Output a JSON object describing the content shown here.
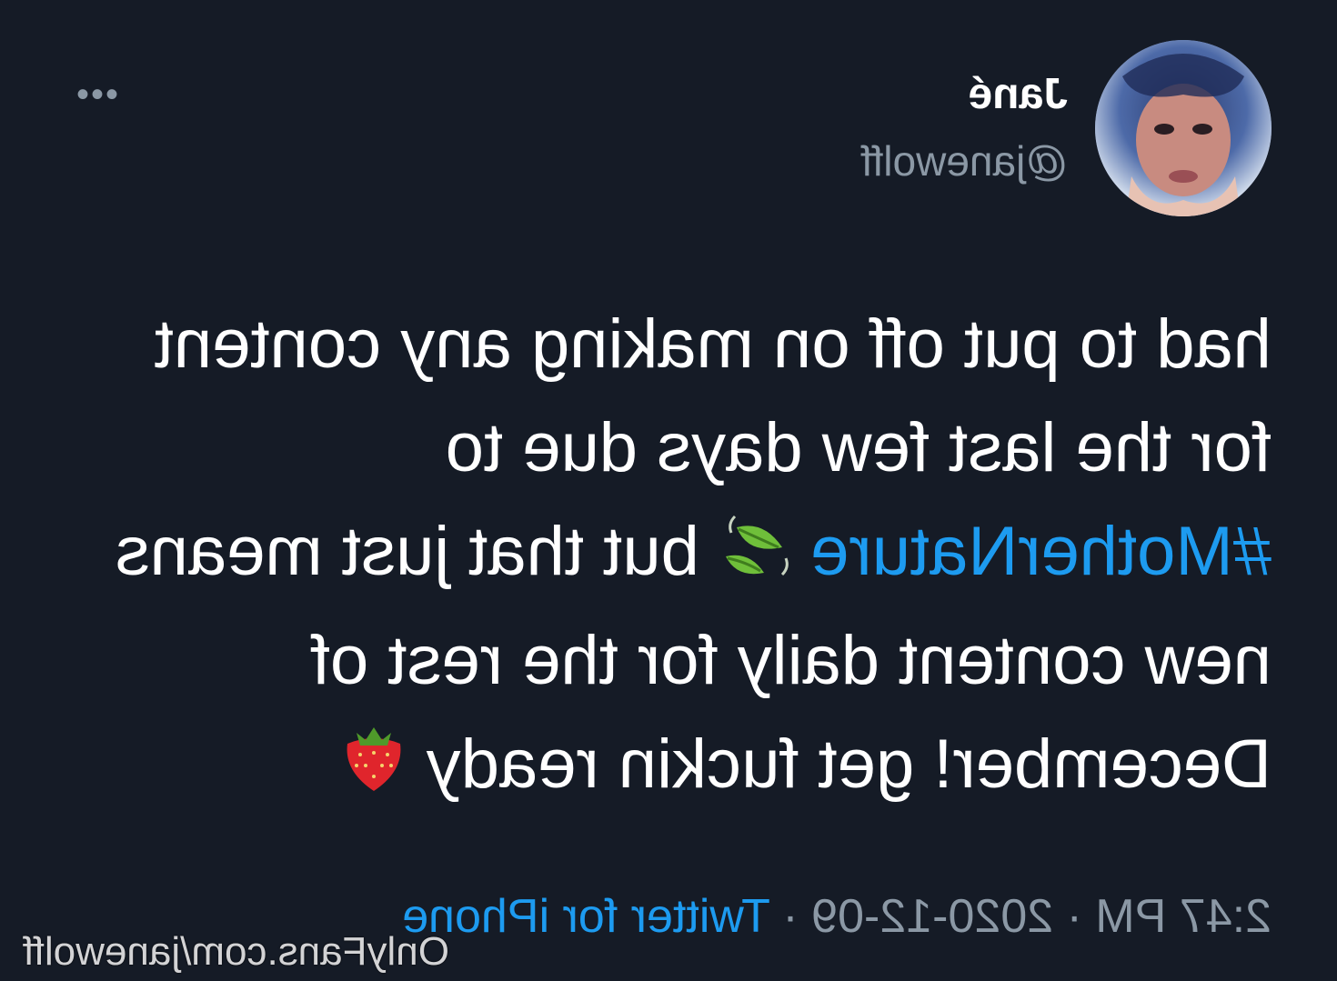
{
  "author": {
    "display_name": "Jané",
    "handle": "@janewolff"
  },
  "more_icon": "more-horizontal-icon",
  "tweet": {
    "line1": "had to put off on making any content",
    "line2": "for the last few days due to",
    "hashtag": "#MotherNature",
    "line3_rest": "but that just means",
    "line4": "new content daily for the rest of",
    "line5": "December! get fuckin ready",
    "emoji_1": "leaf-fluttering-icon",
    "emoji_2": "strawberry-icon"
  },
  "meta": {
    "time": "2:47 PM",
    "separator": "·",
    "date": "2020-12-09",
    "source": "Twitter for iPhone"
  },
  "watermark": "OnlyFans.com/janewolff",
  "colors": {
    "background": "#151b26",
    "link": "#1d9bf0",
    "secondary": "#8b98a5",
    "text": "#ffffff"
  }
}
